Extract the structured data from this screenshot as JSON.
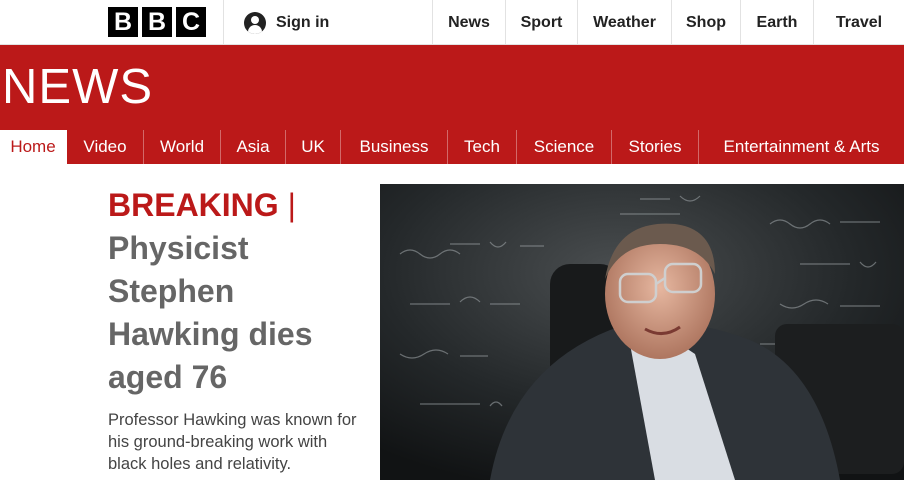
{
  "header": {
    "logo_letters": [
      "B",
      "B",
      "C"
    ],
    "signin_label": "Sign in",
    "signin_icon": "user-icon",
    "nav": [
      "News",
      "Sport",
      "Weather",
      "Shop",
      "Earth",
      "Travel"
    ]
  },
  "news": {
    "title": "NEWS",
    "nav": [
      "Home",
      "Video",
      "World",
      "Asia",
      "UK",
      "Business",
      "Tech",
      "Science",
      "Stories",
      "Entertainment & Arts"
    ],
    "active_index": 0
  },
  "story": {
    "tag": "BREAKING",
    "separator": "|",
    "headline": "Physicist Stephen Hawking dies aged 76",
    "summary": "Professor Hawking was known for his ground-breaking work with black holes and relativity."
  },
  "colors": {
    "brand_red": "#bb1919",
    "headline_grey": "#666666"
  }
}
